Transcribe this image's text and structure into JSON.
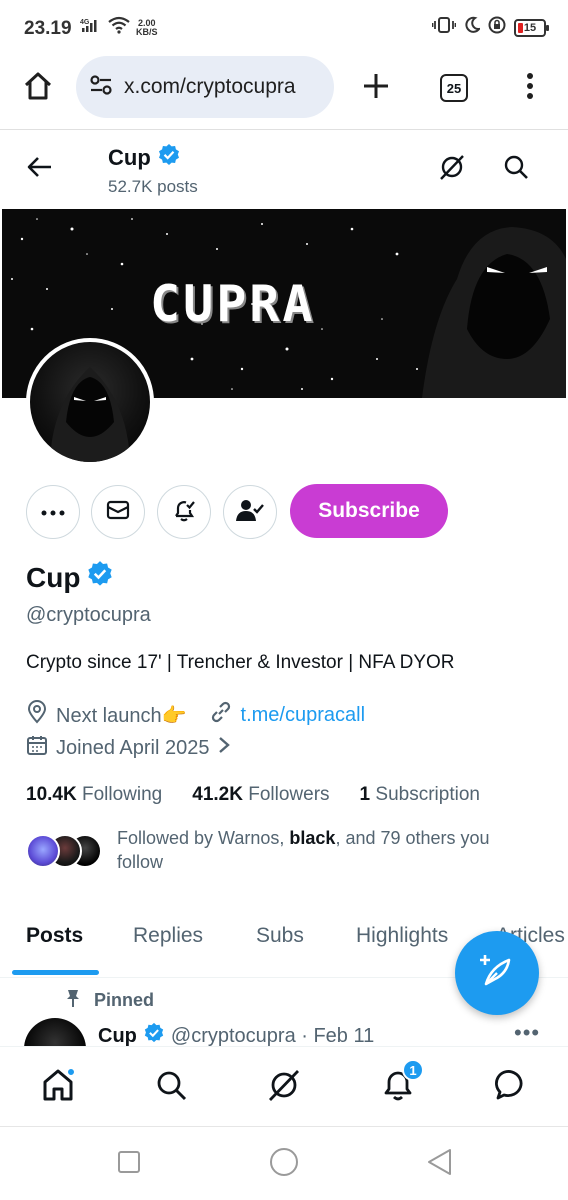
{
  "status_bar": {
    "time": "23.19",
    "net_type": "4G",
    "net_speed_value": "2.00",
    "net_speed_unit": "KB/S",
    "battery": "15"
  },
  "browser": {
    "url": "x.com/cryptocupra",
    "tab_count": "25"
  },
  "header": {
    "name": "Cup",
    "posts_count": "52.7K posts"
  },
  "banner": {
    "text": "CUPRA"
  },
  "actions": {
    "subscribe_label": "Subscribe"
  },
  "profile": {
    "name": "Cup",
    "handle": "@cryptocupra",
    "bio": "Crypto since 17' | Trencher & Investor | NFA DYOR",
    "location": "Next launch👉",
    "link": "t.me/cupracall",
    "joined": "Joined April 2025",
    "following_count": "10.4K",
    "following_label": "Following",
    "followers_count": "41.2K",
    "followers_label": "Followers",
    "subscriptions_count": "1",
    "subscriptions_label": "Subscription",
    "followed_by_prefix": "Followed by Warnos, ",
    "followed_by_bold": "black",
    "followed_by_suffix": ", and 79 others you follow"
  },
  "tabs": [
    "Posts",
    "Replies",
    "Subs",
    "Highlights",
    "Articles"
  ],
  "pinned_post": {
    "pinned_label": "Pinned",
    "name": "Cup",
    "handle_date": "@cryptocupra · Feb 11",
    "more": "•••"
  },
  "bottom_nav": {
    "notifications_badge": "1"
  },
  "colors": {
    "accent": "#1d9bf0",
    "subscribe": "#c93cd3",
    "text_primary": "#0f1419",
    "text_secondary": "#536471"
  }
}
